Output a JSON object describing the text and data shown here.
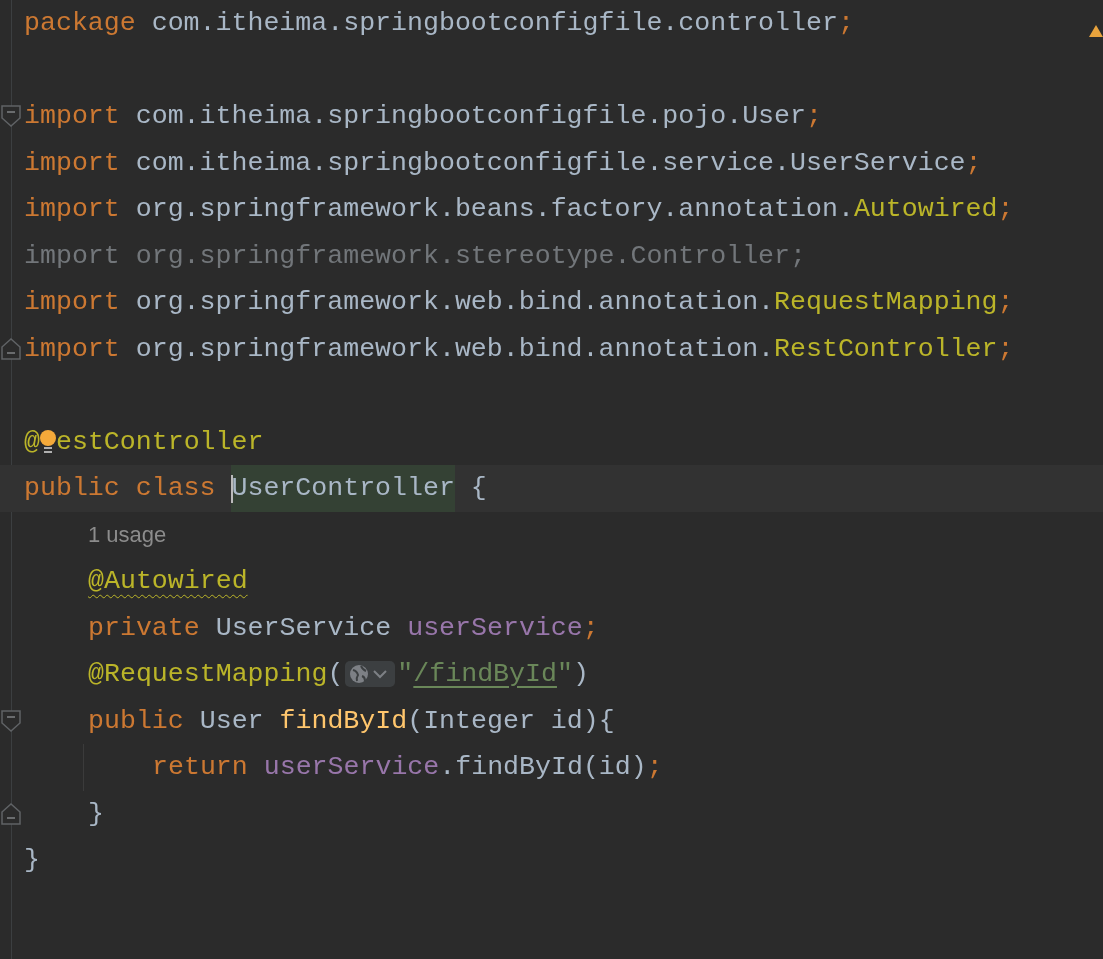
{
  "editor": {
    "lines": [
      {
        "current": false,
        "tokens": [
          {
            "kind": "keyword",
            "text": "package "
          },
          {
            "kind": "plain",
            "text": "com.itheima.springbootconfigfile.controller"
          },
          {
            "kind": "semicolon",
            "text": ";"
          }
        ]
      },
      {
        "current": false
      },
      {
        "current": false,
        "fold_start": true,
        "tokens": [
          {
            "kind": "keyword",
            "text": "import "
          },
          {
            "kind": "plain",
            "text": "com.itheima.springbootconfigfile.pojo.User"
          },
          {
            "kind": "semicolon",
            "text": ";"
          }
        ]
      },
      {
        "current": false,
        "tokens": [
          {
            "kind": "keyword",
            "text": "import "
          },
          {
            "kind": "plain",
            "text": "com.itheima.springbootconfigfile.service.UserService"
          },
          {
            "kind": "semicolon",
            "text": ";"
          }
        ]
      },
      {
        "current": false,
        "tokens": [
          {
            "kind": "keyword",
            "text": "import "
          },
          {
            "kind": "plain",
            "text": "org.springframework.beans.factory.annotation."
          },
          {
            "kind": "annotation",
            "text": "Autowired"
          },
          {
            "kind": "semicolon",
            "text": ";"
          }
        ]
      },
      {
        "current": false,
        "tokens": [
          {
            "kind": "unused",
            "text": "import org.springframework.stereotype.Controller;"
          }
        ]
      },
      {
        "current": false,
        "tokens": [
          {
            "kind": "keyword",
            "text": "import "
          },
          {
            "kind": "plain",
            "text": "org.springframework.web.bind.annotation."
          },
          {
            "kind": "annotation",
            "text": "RequestMapping"
          },
          {
            "kind": "semicolon",
            "text": ";"
          }
        ]
      },
      {
        "current": false,
        "fold_end": true,
        "tokens": [
          {
            "kind": "keyword",
            "text": "import "
          },
          {
            "kind": "plain",
            "text": "org.springframework.web.bind.annotation."
          },
          {
            "kind": "annotation",
            "text": "RestController"
          },
          {
            "kind": "semicolon",
            "text": ";"
          }
        ]
      },
      {
        "current": false
      },
      {
        "current": false,
        "tokens": [
          {
            "kind": "annotation",
            "text": "@"
          },
          {
            "kind": "bulb"
          },
          {
            "kind": "annotation",
            "text": "estController"
          }
        ]
      },
      {
        "current": true,
        "tokens": [
          {
            "kind": "keyword",
            "text": "public class "
          },
          {
            "kind": "plain",
            "text": "UserController",
            "highlighted": true
          },
          {
            "kind": "plain",
            "text": " {"
          }
        ]
      },
      {
        "current": false,
        "tokens": [
          {
            "kind": "inlay",
            "text": "1 usage"
          }
        ]
      },
      {
        "current": false,
        "tokens": [
          {
            "kind": "annotation",
            "text": "@Autowired",
            "warning": true
          }
        ]
      },
      {
        "current": false,
        "tokens": [
          {
            "kind": "keyword",
            "text": "private "
          },
          {
            "kind": "plain",
            "text": "UserService "
          },
          {
            "kind": "field",
            "text": "userService"
          },
          {
            "kind": "semicolon",
            "text": ";"
          }
        ]
      },
      {
        "current": false,
        "tokens": [
          {
            "kind": "annotation",
            "text": "@RequestMapping"
          },
          {
            "kind": "plain",
            "text": "("
          },
          {
            "kind": "url-inlay"
          },
          {
            "kind": "string",
            "text": "\""
          },
          {
            "kind": "string",
            "text": "/findById",
            "link": true
          },
          {
            "kind": "string",
            "text": "\""
          },
          {
            "kind": "plain",
            "text": ")"
          }
        ]
      },
      {
        "current": false,
        "fold_start": true,
        "tokens": [
          {
            "kind": "keyword",
            "text": "public "
          },
          {
            "kind": "plain",
            "text": "User "
          },
          {
            "kind": "method",
            "text": "findById"
          },
          {
            "kind": "plain",
            "text": "(Integer id){"
          }
        ]
      },
      {
        "current": false,
        "guide": true,
        "tokens": [
          {
            "kind": "keyword",
            "text": "return "
          },
          {
            "kind": "field",
            "text": "userService"
          },
          {
            "kind": "plain",
            "text": ".findById(id)"
          },
          {
            "kind": "semicolon",
            "text": ";"
          }
        ]
      },
      {
        "current": false,
        "fold_end": true,
        "tokens": [
          {
            "kind": "plain",
            "text": "}"
          }
        ]
      },
      {
        "current": false,
        "tokens": [
          {
            "kind": "plain",
            "text": "}"
          }
        ]
      }
    ]
  }
}
